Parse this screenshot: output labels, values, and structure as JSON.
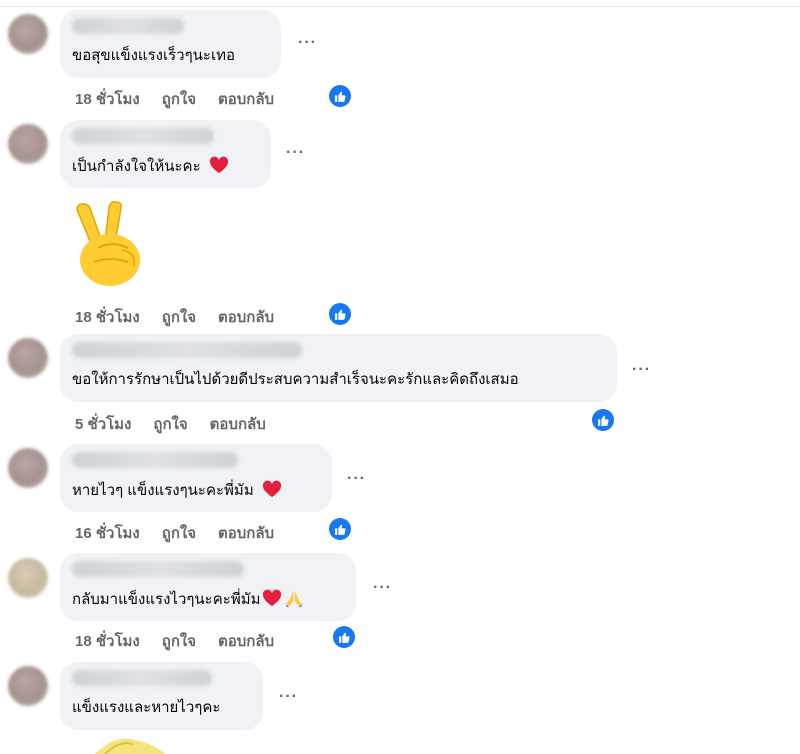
{
  "comments": [
    {
      "text": "ขอสุขแข็งแรงเร็วๆนะเทอ",
      "time": "18 ชั่วโมง",
      "like": "ถูกใจ",
      "reply": "ตอบกลับ",
      "reaction_icon": "like-icon"
    },
    {
      "text": "เป็นกำลังใจให้นะคะ",
      "emoji": "red-heart-icon",
      "sticker": "victory-hand-emoji",
      "time": "18 ชั่วโมง",
      "like": "ถูกใจ",
      "reply": "ตอบกลับ",
      "reaction_icon": "like-icon"
    },
    {
      "text": "ขอให้การรักษาเป็นไปด้วยดีประสบความสำเร็จนะคะรักและคิดถึงเสมอ",
      "time": "5 ชั่วโมง",
      "like": "ถูกใจ",
      "reply": "ตอบกลับ",
      "reaction_icon": "like-icon"
    },
    {
      "text": "หายไวๆ แข็งแรงๆนะคะพี่มัม",
      "emoji": "red-heart-icon",
      "time": "16 ชั่วโมง",
      "like": "ถูกใจ",
      "reply": "ตอบกลับ",
      "reaction_icon": "like-icon"
    },
    {
      "text": "กลับมาแข็งแรงไวๆนะคะพี่มัม",
      "emoji": "red-heart-icon folded-hands-icon",
      "time": "18 ชั่วโมง",
      "like": "ถูกใจ",
      "reply": "ตอบกลับ",
      "reaction_icon": "like-icon"
    },
    {
      "text": "แข็งแรงและหายไวๆคะ",
      "emoji": "",
      "time": "",
      "like": "",
      "reply": ""
    }
  ],
  "more_label": "···",
  "colors": {
    "bubble": "#f0f2f5",
    "meta": "#65676b",
    "like_blue": "#1877f2",
    "heart": "#e41e3f"
  }
}
